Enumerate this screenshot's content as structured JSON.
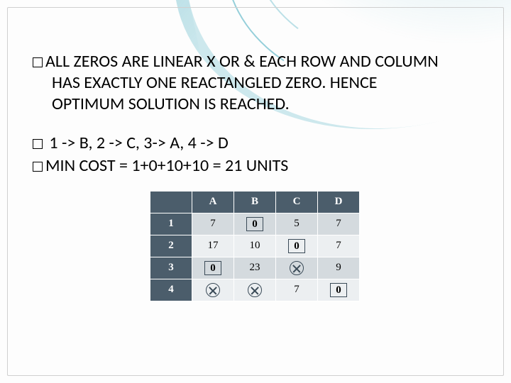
{
  "heading": {
    "l1": "ALL ZEROS ARE LINEAR X OR  & EACH ROW AND COLUMN",
    "l2": "HAS EXACTLY ONE REACTANGLED ZERO. HENCE",
    "l3": "OPTIMUM SOLUTION IS REACHED."
  },
  "assignments": " 1 -> B, 2 -> C, 3-> A, 4 -> D",
  "mincost": "MIN COST = 1+0+10+10 = 21 UNITS",
  "table": {
    "cols": [
      "A",
      "B",
      "C",
      "D"
    ],
    "rows": [
      "1",
      "2",
      "3",
      "4"
    ],
    "cells": [
      [
        {
          "v": "7",
          "t": "plain"
        },
        {
          "v": "0",
          "t": "boxed"
        },
        {
          "v": "5",
          "t": "plain"
        },
        {
          "v": "7",
          "t": "plain"
        }
      ],
      [
        {
          "v": "17",
          "t": "plain"
        },
        {
          "v": "10",
          "t": "plain"
        },
        {
          "v": "0",
          "t": "boxed"
        },
        {
          "v": "7",
          "t": "plain"
        }
      ],
      [
        {
          "v": "0",
          "t": "boxed"
        },
        {
          "v": "23",
          "t": "plain"
        },
        {
          "v": "",
          "t": "crossed"
        },
        {
          "v": "9",
          "t": "plain"
        }
      ],
      [
        {
          "v": "",
          "t": "crossed"
        },
        {
          "v": "",
          "t": "crossed"
        },
        {
          "v": "7",
          "t": "plain"
        },
        {
          "v": "0",
          "t": "boxed"
        }
      ]
    ]
  }
}
